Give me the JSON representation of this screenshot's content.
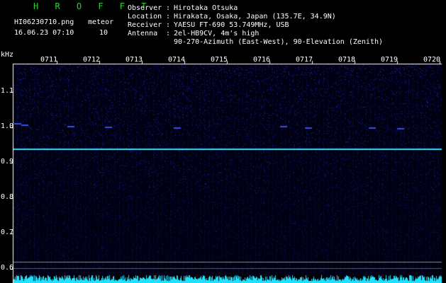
{
  "header": {
    "app_title": "H R O F F T",
    "filename": "HI06230710.png",
    "datetime": "16.06.23 07:10",
    "meteor_label": "meteor",
    "meteor_count": "10",
    "rows": [
      {
        "label": "Observer",
        "sep": ":",
        "value": "Hirotaka Otsuka"
      },
      {
        "label": "Location",
        "sep": ":",
        "value": "Hirakata, Osaka, Japan (135.7E, 34.9N)"
      },
      {
        "label": "Receiver",
        "sep": ":",
        "value": "YAESU FT-690 53.749MHz, USB"
      },
      {
        "label": "Antenna",
        "sep": ":",
        "value": "2el-HB9CV, 4m's high"
      },
      {
        "label": "",
        "sep": "",
        "value": "90-270-Azimuth (East-West), 90-Elevation (Zenith)"
      }
    ]
  },
  "colors": {
    "title": "#33cc33",
    "text": "#ffffff",
    "background": "#000010",
    "noise": "#1a22a0",
    "carrier": "#3fd8ff",
    "baseline": "#1fe0ff"
  },
  "plot": {
    "y_unit": "kHz",
    "y_ticks": [
      "1.1",
      "1.0",
      "0.9",
      "0.8",
      "0.7",
      "0.6"
    ],
    "x_ticks": [
      "0711",
      "0712",
      "0713",
      "0714",
      "0715",
      "0716",
      "0717",
      "0718",
      "0719",
      "0720"
    ]
  }
}
